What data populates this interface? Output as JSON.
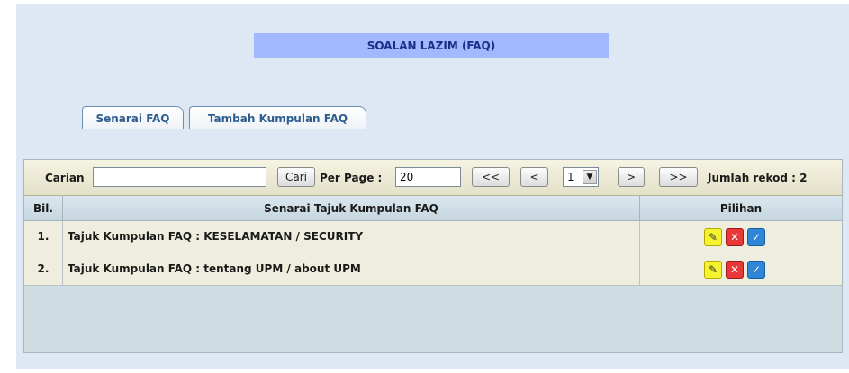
{
  "page": {
    "title": "SOALAN LAZIM (FAQ)"
  },
  "tabs": [
    {
      "label": "Senarai FAQ"
    },
    {
      "label": "Tambah Kumpulan FAQ"
    }
  ],
  "toolbar": {
    "search_label": "Carian",
    "search_value": "",
    "search_button": "Cari",
    "per_page_label": "Per Page :",
    "per_page_value": "20",
    "first_button": "<<",
    "prev_button": "<",
    "page_select": "1",
    "next_button": ">",
    "last_button": ">>",
    "record_count": "Jumlah rekod : 2"
  },
  "table": {
    "headers": {
      "no": "Bil.",
      "title": "Senarai Tajuk Kumpulan FAQ",
      "actions": "Pilihan"
    },
    "rows": [
      {
        "no": "1.",
        "title": "Tajuk Kumpulan FAQ : KESELAMATAN / SECURITY"
      },
      {
        "no": "2.",
        "title": "Tajuk Kumpulan FAQ : tentang UPM / about UPM"
      }
    ]
  },
  "icons": {
    "edit": "wrench-icon",
    "delete": "close-icon",
    "approve": "check-icon"
  },
  "colors": {
    "title_bar": "#a3b9ff",
    "panel": "#dde8f4",
    "edit": "#f5f230",
    "delete": "#e8383a",
    "approve": "#2f86d6"
  }
}
